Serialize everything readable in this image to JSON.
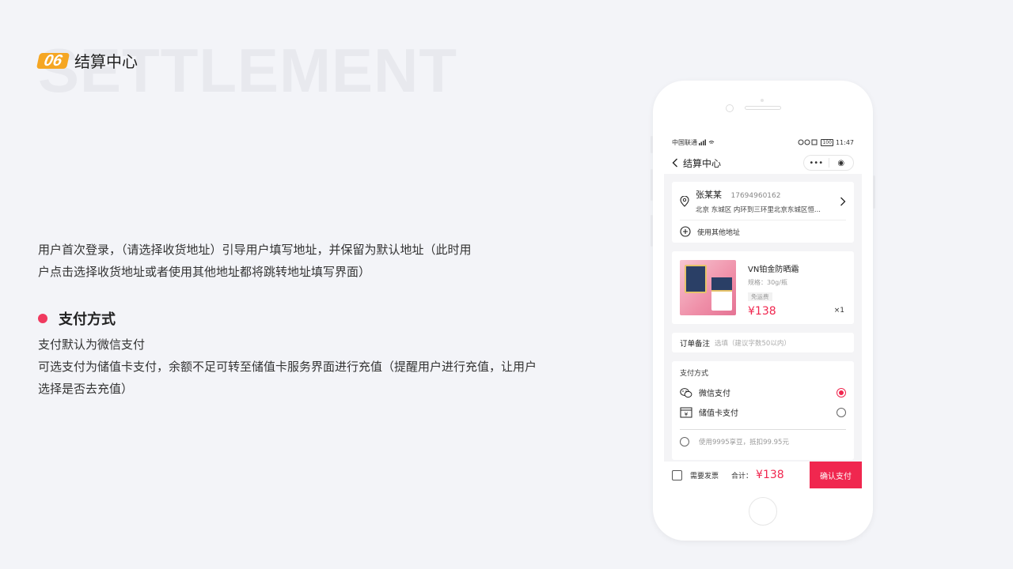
{
  "slide": {
    "watermark": "SETTLEMENT",
    "number": "06",
    "title": "结算中心",
    "para1_line1": "用户首次登录，（请选择收货地址）引导用户填写地址，并保留为默认地址（此时用",
    "para1_line2": "户点击选择收货地址或者使用其他地址都将跳转地址填写界面）",
    "section_title": "支付方式",
    "para2_line1": "支付默认为微信支付",
    "para2_line2": "可选支付为储值卡支付，余额不足可转至储值卡服务界面进行充值（提醒用户进行充值，让用户",
    "para2_line3": "选择是否去充值）",
    "accent_color": "#f03a5f"
  },
  "phone": {
    "status": {
      "carrier": "中国联通",
      "battery": "100",
      "time": "11:47"
    },
    "nav": {
      "title": "结算中心",
      "more_icon": "•••",
      "close_icon": "◉"
    },
    "address": {
      "name": "张某某",
      "phone": "17694960162",
      "detail": "北京 东城区 内环到三环里北京东城区恒...",
      "other_label": "使用其他地址"
    },
    "product": {
      "name": "VN铂金防晒霜",
      "spec": "规格：30g/瓶",
      "tag": "免运费",
      "price": "¥138",
      "qty": "×1"
    },
    "remark": {
      "label": "订单备注",
      "placeholder": "选填（建议字数50以内）"
    },
    "payment": {
      "title": "支付方式",
      "options": [
        {
          "label": "微信支付",
          "selected": true
        },
        {
          "label": "储值卡支付",
          "selected": false
        }
      ],
      "bean_text": "使用9995享豆，抵扣99.95元"
    },
    "bottom": {
      "invoice_label": "需要发票",
      "total_label": "合计：",
      "total_amount": "¥138",
      "confirm_label": "确认支付"
    }
  }
}
